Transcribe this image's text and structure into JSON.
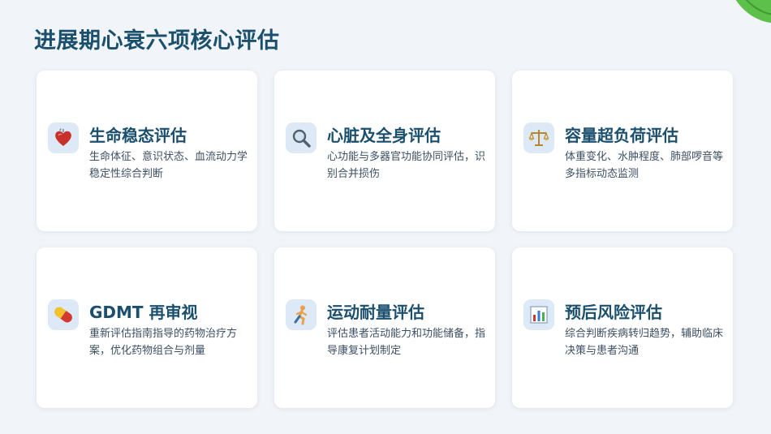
{
  "page": {
    "title": "进展期心衰六项核心评估"
  },
  "cards": [
    {
      "icon": "heart-icon",
      "title": "生命稳态评估",
      "desc": "生命体征、意识状态、血流动力学稳定性综合判断"
    },
    {
      "icon": "magnifier-icon",
      "title": "心脏及全身评估",
      "desc": "心功能与多器官功能协同评估，识别合并损伤"
    },
    {
      "icon": "balance-scale-icon",
      "title": "容量超负荷评估",
      "desc": "体重变化、水肿程度、肺部啰音等多指标动态监测"
    },
    {
      "icon": "pill-icon",
      "title": "GDMT 再审视",
      "desc": "重新评估指南指导的药物治疗方案，优化药物组合与剂量"
    },
    {
      "icon": "runner-icon",
      "title": "运动耐量评估",
      "desc": "评估患者活动能力和功能储备，指导康复计划制定"
    },
    {
      "icon": "bar-chart-icon",
      "title": "预后风险评估",
      "desc": "综合判断疾病转归趋势，辅助临床决策与患者沟通"
    }
  ]
}
